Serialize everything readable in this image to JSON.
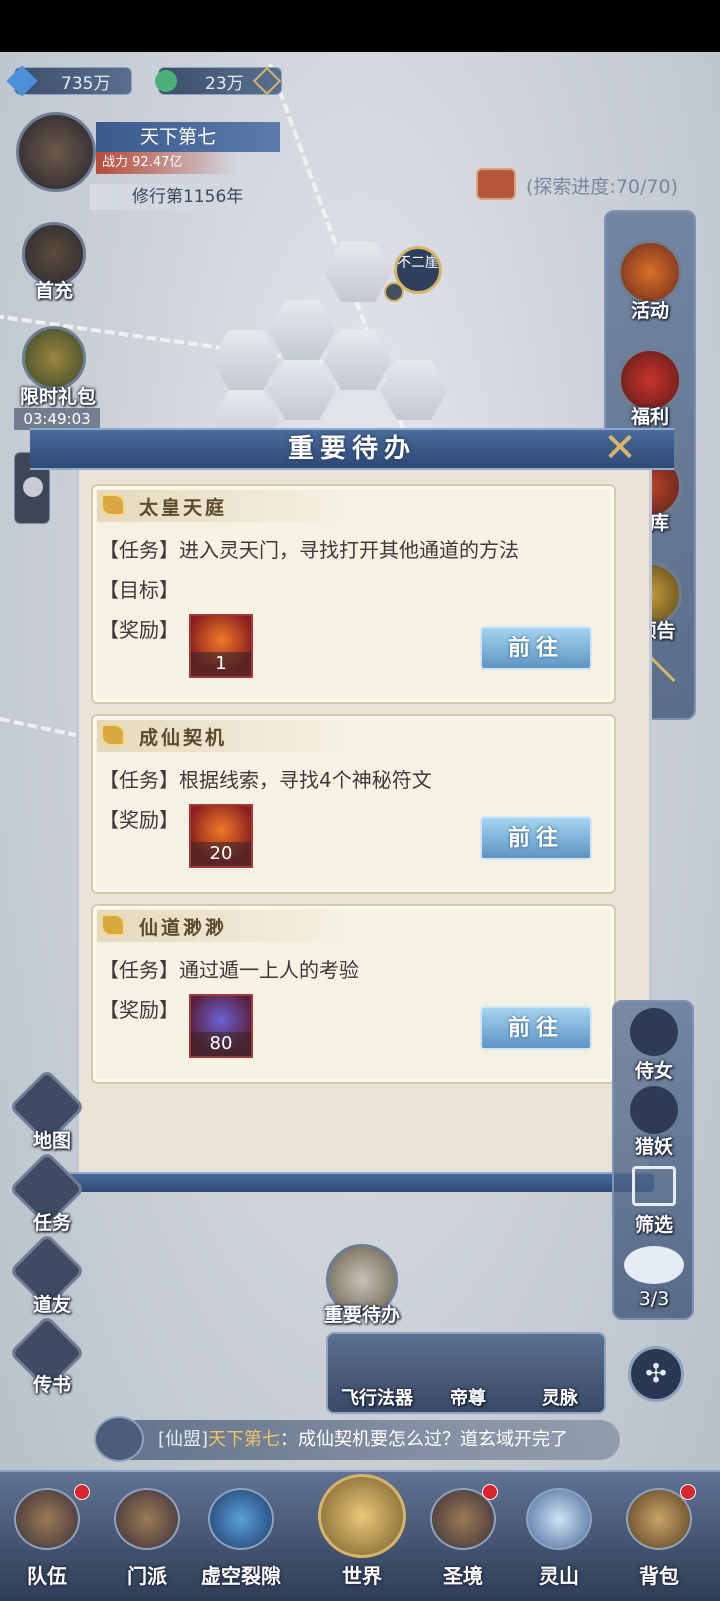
{
  "resources": {
    "spirit_stone": "735万",
    "jade": "23万"
  },
  "player": {
    "name": "天下第七",
    "power_label": "战力",
    "power_value": "92.47亿",
    "cultivation": "修行第1156年"
  },
  "explore": {
    "progress": "(探索进度:70/70)"
  },
  "map": {
    "location_badge": "不二崖"
  },
  "left_icons": {
    "first_charge": "首充",
    "limited_gift": "限时礼包",
    "countdown": "03:49:03"
  },
  "right_icons": {
    "activity": "活动",
    "welfare": "福利",
    "treasury": "宝库",
    "preview": "能预告"
  },
  "dialog": {
    "title": "重要待办",
    "cards": [
      {
        "title": "太皇天庭",
        "task_label": "【任务】",
        "task": "进入灵天门，寻找打开其他通道的方法",
        "goal_label": "【目标】",
        "reward_label": "【奖励】",
        "reward_count": "1",
        "button": "前往"
      },
      {
        "title": "成仙契机",
        "task_label": "【任务】",
        "task": "根据线索，寻找4个神秘符文",
        "reward_label": "【奖励】",
        "reward_count": "20",
        "button": "前往"
      },
      {
        "title": "仙道渺渺",
        "task_label": "【任务】",
        "task": "通过遁一上人的考验",
        "reward_label": "【奖励】",
        "reward_count": "80",
        "button": "前往"
      }
    ]
  },
  "left_menu": {
    "map": "地图",
    "task": "任务",
    "friend": "道友",
    "letter": "传书"
  },
  "right_menu": {
    "maid": "侍女",
    "monster": "猎妖",
    "filter": "筛选",
    "count": "3/3"
  },
  "todo_button": "重要待办",
  "tray": {
    "flying": "飞行法器",
    "emperor": "帝尊",
    "vein": "灵脉"
  },
  "chat": {
    "channel": "[仙盟]",
    "sender": "天下第七",
    "message": "：成仙契机要怎么过？道玄域开完了"
  },
  "nav": [
    "队伍",
    "门派",
    "虚空裂隙",
    "世界",
    "圣境",
    "灵山",
    "背包"
  ]
}
